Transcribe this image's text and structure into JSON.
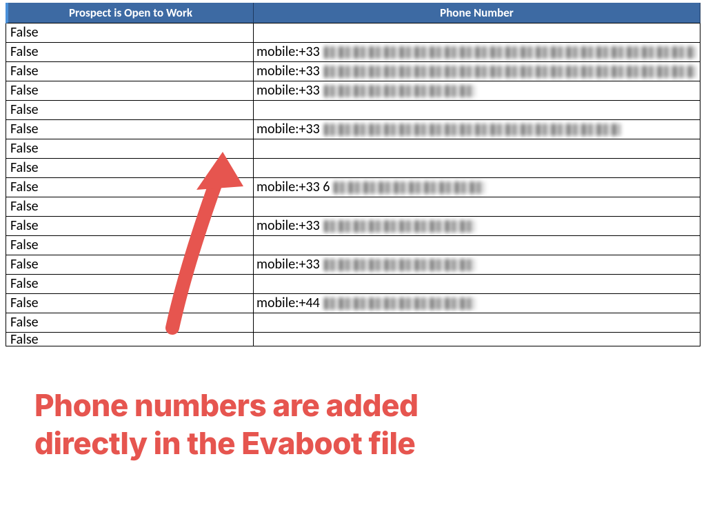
{
  "header": {
    "colA": "Prospect is Open to Work",
    "colB": "Phone Number"
  },
  "value": "False",
  "phone_prefix": {
    "r1": "mobile:+33",
    "r2": "mobile:+33",
    "r3": "mobile:+33",
    "r5": "mobile:+33",
    "r8": "mobile:+33 6",
    "r10": "mobile:+33",
    "r12": "mobile:+33",
    "r14": "mobile:+44"
  },
  "rows_total": 17,
  "caption_line1": "Phone numbers are added",
  "caption_line2": "directly in the Evaboot file",
  "arrow_color": "#e6554f",
  "header_bg": "#3d6aa3"
}
